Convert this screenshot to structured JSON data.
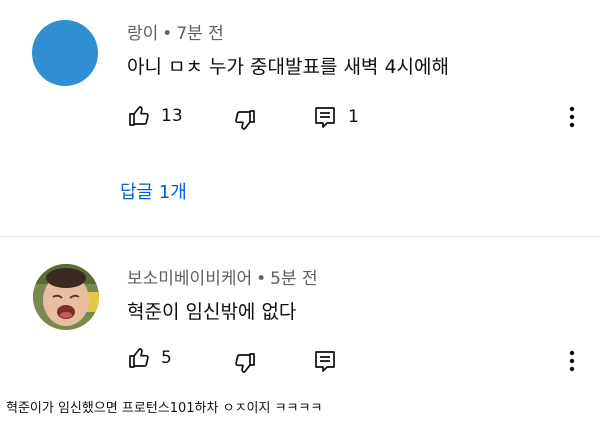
{
  "comments": [
    {
      "author": "랑이",
      "time": "7분 전",
      "text": "아니 ㅁㅊ 누가 중대발표를 새벽 4시에해",
      "likes": "13",
      "replies_count": "1",
      "replies_label": "답글 1개",
      "avatar_color": "#2f8fd0"
    },
    {
      "author": "보소미베이비케어",
      "time": "5분 전",
      "text": "혁준이 임신밖에 없다",
      "likes": "5",
      "avatar_color": "#c9a27a"
    }
  ],
  "meta_separator": "•",
  "caption": "혁준이가 임신했으면 프로턴스101하차 ㅇㅈ이지 ㅋㅋㅋㅋ",
  "colors": {
    "link": "#065fd4",
    "meta": "#606060",
    "text": "#0f0f0f",
    "divider": "#e5e5e5"
  },
  "icons": [
    "like-icon",
    "dislike-icon",
    "reply-icon",
    "more-options-icon"
  ]
}
